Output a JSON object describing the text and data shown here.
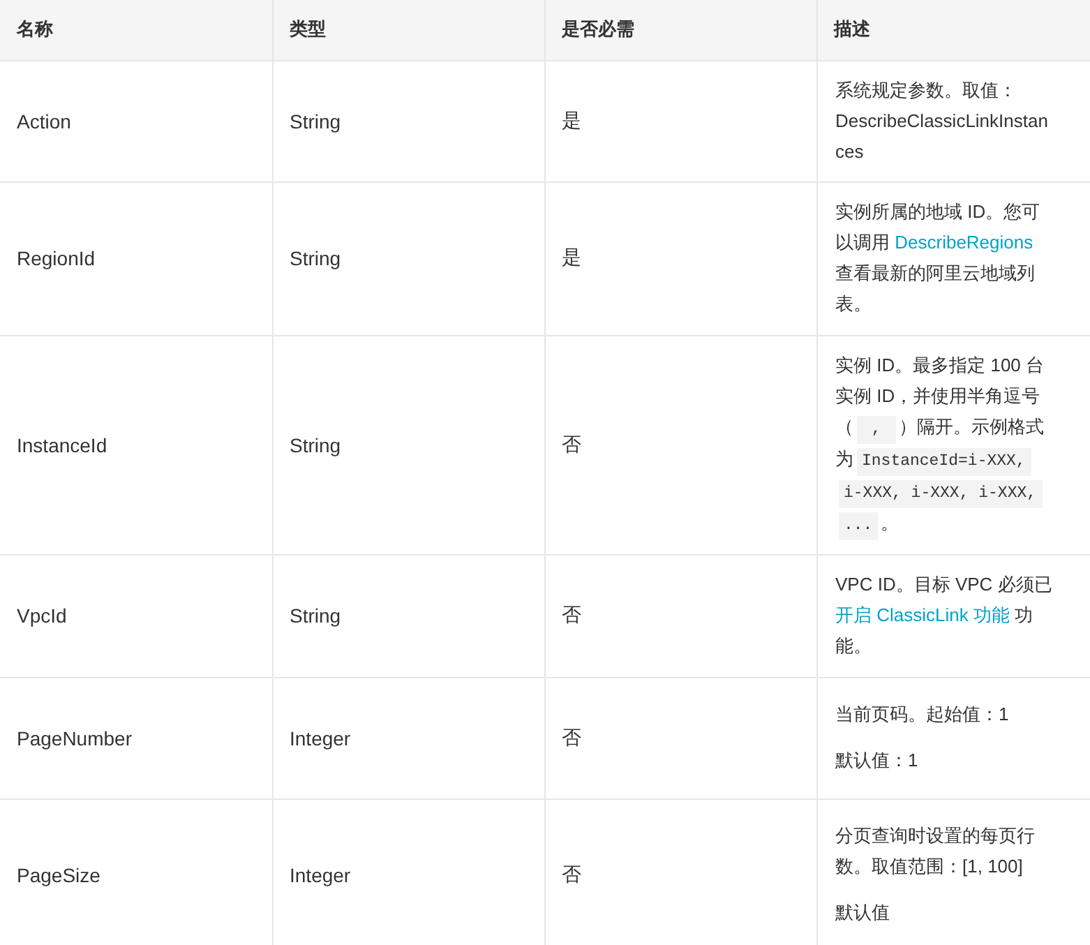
{
  "table": {
    "columns": [
      "名称",
      "类型",
      "是否必需",
      "描述"
    ],
    "rows": [
      {
        "name": "Action",
        "type": "String",
        "required": "是",
        "description": [
          [
            {
              "kind": "text",
              "text": "系统规定参数。取值：DescribeClassicLinkInstances"
            }
          ]
        ]
      },
      {
        "name": "RegionId",
        "type": "String",
        "required": "是",
        "description": [
          [
            {
              "kind": "text",
              "text": "实例所属的地域 ID。您可以调用 "
            },
            {
              "kind": "link",
              "text": "DescribeRegions"
            },
            {
              "kind": "text",
              "text": " 查看最新的阿里云地域列表。"
            }
          ]
        ]
      },
      {
        "name": "InstanceId",
        "type": "String",
        "required": "否",
        "description": [
          [
            {
              "kind": "text",
              "text": "实例 ID。最多指定 100 台实例 ID，并使用半角逗号（"
            },
            {
              "kind": "code",
              "text": " , "
            },
            {
              "kind": "text",
              "text": "）隔开。示例格式为"
            },
            {
              "kind": "code",
              "text": "InstanceId=i-XXX,"
            },
            {
              "kind": "code",
              "text": "i-XXX, i-XXX, i-XXX,"
            },
            {
              "kind": "code",
              "text": "..."
            },
            {
              "kind": "text",
              "text": "。"
            }
          ]
        ]
      },
      {
        "name": "VpcId",
        "type": "String",
        "required": "否",
        "description": [
          [
            {
              "kind": "text",
              "text": "VPC ID。目标 VPC 必须已"
            },
            {
              "kind": "link",
              "text": "开启 ClassicLink 功能"
            },
            {
              "kind": "text",
              "text": " 功能。"
            }
          ]
        ]
      },
      {
        "name": "PageNumber",
        "type": "Integer",
        "required": "否",
        "description": [
          [
            {
              "kind": "text",
              "text": "当前页码。起始值：1"
            }
          ],
          [
            {
              "kind": "text",
              "text": "默认值：1"
            }
          ]
        ]
      },
      {
        "name": "PageSize",
        "type": "Integer",
        "required": "否",
        "description": [
          [
            {
              "kind": "text",
              "text": "分页查询时设置的每页行数。取值范围：[1, 100]"
            }
          ],
          [
            {
              "kind": "text",
              "text": "默认值"
            }
          ]
        ]
      }
    ]
  }
}
